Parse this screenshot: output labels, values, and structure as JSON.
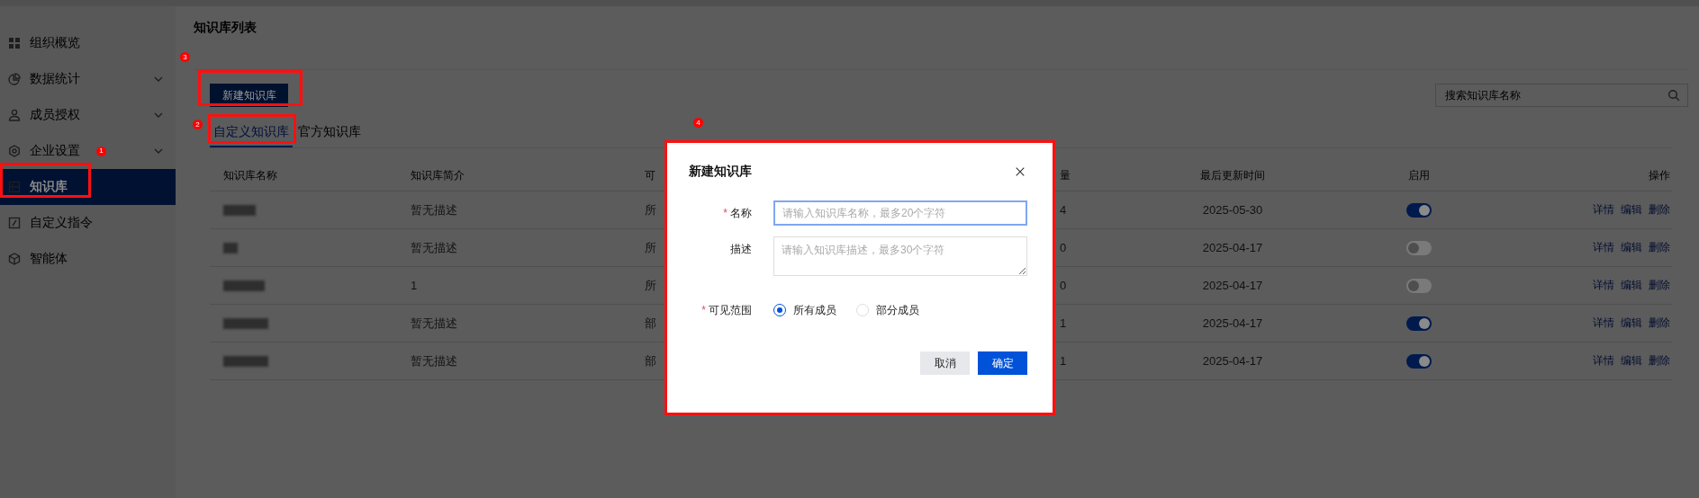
{
  "sidebar": {
    "items": [
      {
        "label": "组织概览",
        "selected": false,
        "has_submenu": false
      },
      {
        "label": "数据统计",
        "selected": false,
        "has_submenu": true
      },
      {
        "label": "成员授权",
        "selected": false,
        "has_submenu": true
      },
      {
        "label": "企业设置",
        "selected": false,
        "has_submenu": true,
        "badge": "1"
      },
      {
        "label": "知识库",
        "selected": true,
        "has_submenu": false
      },
      {
        "label": "自定义指令",
        "selected": false,
        "has_submenu": false
      },
      {
        "label": "智能体",
        "selected": false,
        "has_submenu": false
      }
    ]
  },
  "page_title": "知识库列表",
  "toolbar": {
    "new_button": "新建知识库",
    "badge": "3",
    "search": {
      "placeholder": "搜索知识库名称"
    }
  },
  "tabs": [
    {
      "label": "自定义知识库",
      "selected": true
    },
    {
      "label": "官方知识库",
      "selected": false
    }
  ],
  "tabs_badge": "2",
  "table": {
    "columns": [
      "知识库名称",
      "知识库简介",
      "可",
      "量",
      "最后更新时间",
      "启用",
      "操作"
    ],
    "rows": [
      {
        "description": "暂无描述",
        "visibility": "所",
        "count": "4",
        "updated": "2025-05-30",
        "enabled": true,
        "actions": [
          "详情",
          "编辑",
          "删除"
        ]
      },
      {
        "description": "暂无描述",
        "visibility": "所",
        "count": "0",
        "updated": "2025-04-17",
        "enabled": false,
        "actions": [
          "详情",
          "编辑",
          "删除"
        ]
      },
      {
        "description": "1",
        "visibility": "所",
        "count": "0",
        "updated": "2025-04-17",
        "enabled": false,
        "actions": [
          "详情",
          "编辑",
          "删除"
        ]
      },
      {
        "description": "暂无描述",
        "visibility": "部",
        "count": "1",
        "updated": "2025-04-17",
        "enabled": true,
        "actions": [
          "详情",
          "编辑",
          "删除"
        ]
      },
      {
        "description": "暂无描述",
        "visibility": "部",
        "count": "1",
        "updated": "2025-04-17",
        "enabled": true,
        "actions": [
          "详情",
          "编辑",
          "删除"
        ]
      }
    ]
  },
  "dialog": {
    "title": "新建知识库",
    "badge": "4",
    "fields": [
      {
        "kind": "input",
        "label": "名称",
        "required_mark": "*",
        "placeholder": "请输入知识库名称，最多20个字符",
        "focused": true
      },
      {
        "kind": "textarea",
        "label": "描述",
        "placeholder": "请输入知识库描述，最多30个字符",
        "focused": false
      },
      {
        "kind": "radio",
        "label": "可见范围",
        "required_mark": "*",
        "options": [
          {
            "label": "所有成员",
            "selected": true
          },
          {
            "label": "部分成员",
            "selected": false
          }
        ]
      }
    ],
    "buttons": [
      {
        "label": "取消",
        "kind": "secondary"
      },
      {
        "label": "确定",
        "kind": "primary"
      }
    ]
  }
}
